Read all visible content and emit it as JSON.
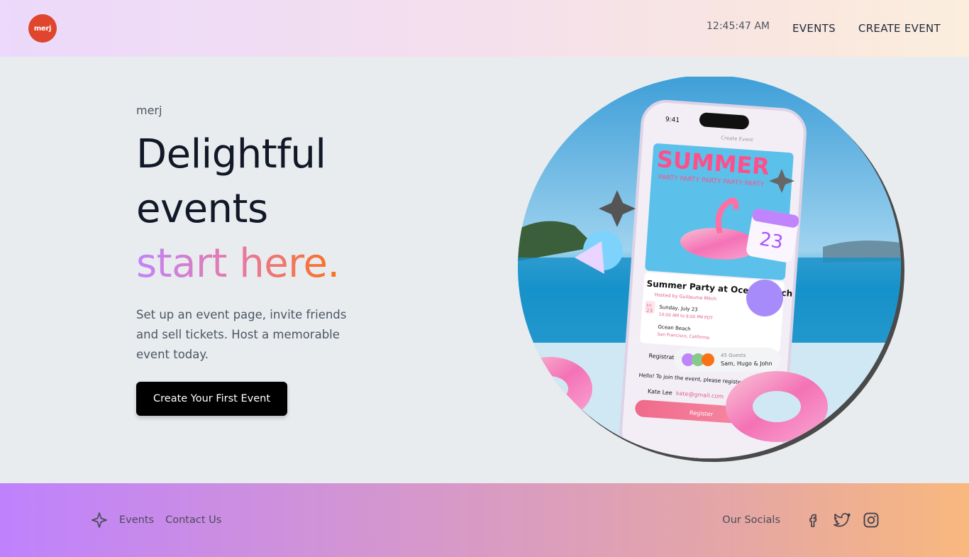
{
  "header": {
    "logo_text": "merj",
    "clock": "12:45:47 AM",
    "nav": {
      "events": "EVENTS",
      "create_event": "CREATE EVENT"
    }
  },
  "hero": {
    "brand": "merj",
    "headline_line1": "Delightful",
    "headline_line2": "events",
    "headline_line3": "start here.",
    "subtext": "Set up an event page, invite friends and sell tickets. Host a memorable event today.",
    "cta_label": "Create Your First Event"
  },
  "hero_image": {
    "phone_time": "9:41",
    "create_event_label": "Create Event",
    "poster_title": "SUMMER",
    "poster_subtitle": "PARTY PARTY PARTY PARTY PARTY",
    "event_title": "Summer Party at Ocean Beach",
    "hosted_by": "Hosted by Guillaume Mitch",
    "date_badge_month": "JUL",
    "date_badge_day": "23",
    "date": "Sunday, July 23",
    "time": "10:00 AM to 8:00 PM PDT",
    "location": "Ocean Beach",
    "location_sub": "San Francisco, California",
    "guests_count": "45 Guests",
    "guests_names": "Sam, Hugo & John",
    "registration_label": "Registration",
    "registration_text": "Hello! To join the event, please register below.",
    "registrant_name": "Kate Lee",
    "registrant_email": "kate@gmail.com",
    "register_button": "Register",
    "calendar_day": "23"
  },
  "footer": {
    "links": {
      "events": "Events",
      "contact": "Contact Us"
    },
    "socials_label": "Our Socials",
    "social_icons": [
      "facebook-icon",
      "twitter-icon",
      "instagram-icon"
    ]
  },
  "colors": {
    "logo": "#e0452d",
    "cta_bg": "#000000",
    "headline_gradient": [
      "#c084fc",
      "#e879a6",
      "#f97316"
    ]
  }
}
